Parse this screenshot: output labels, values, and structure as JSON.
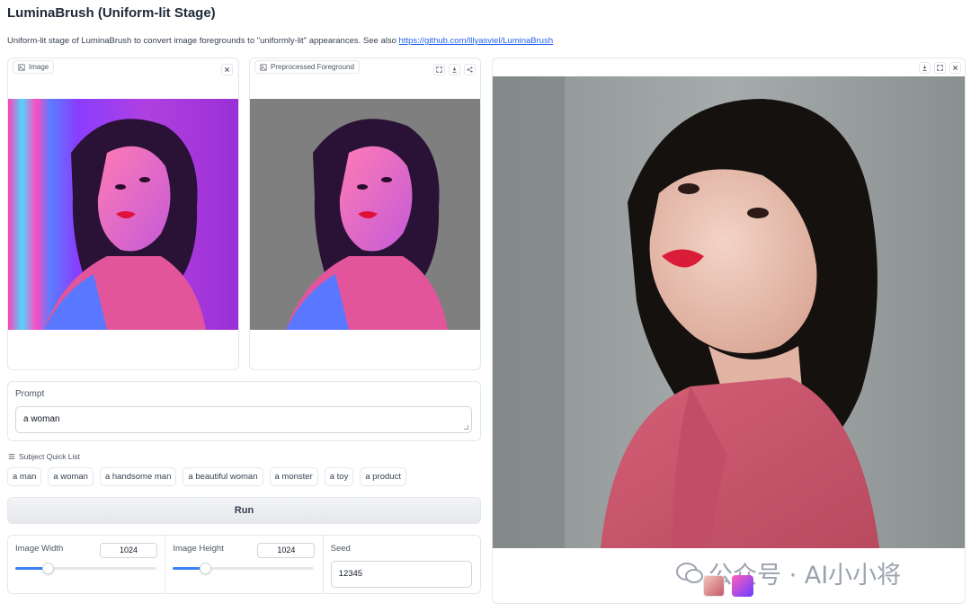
{
  "app": {
    "title": "LuminaBrush (Uniform-lit Stage)",
    "description_prefix": "Uniform-lit stage of LuminaBrush to convert image foregrounds to \"uniformly-lit\" appearances. See also ",
    "link_text": "https://github.com/lllyasviel/LuminaBrush"
  },
  "input_image": {
    "label": "Image",
    "close_icon": "close-icon"
  },
  "preprocessed": {
    "label": "Preprocessed Foreground",
    "icons": [
      "fullscreen-icon",
      "download-icon",
      "share-icon"
    ]
  },
  "output": {
    "icons": [
      "download-icon",
      "fullscreen-icon",
      "close-icon"
    ]
  },
  "prompt": {
    "label": "Prompt",
    "value": "a woman"
  },
  "quick_list": {
    "label": "Subject Quick List",
    "chips": [
      "a man",
      "a woman",
      "a handsome man",
      "a beautiful woman",
      "a monster",
      "a toy",
      "a product"
    ]
  },
  "run_button": {
    "label": "Run"
  },
  "settings": {
    "width": {
      "label": "Image Width",
      "value": "1024",
      "fraction": 0.23
    },
    "height": {
      "label": "Image Height",
      "value": "1024",
      "fraction": 0.23
    },
    "seed": {
      "label": "Seed",
      "value": "12345"
    }
  },
  "watermark": {
    "text": "公众号 · AI小小将"
  },
  "colors": {
    "accent": "#3b82f6",
    "link": "#2563eb",
    "panel_border": "#e5e7eb"
  }
}
